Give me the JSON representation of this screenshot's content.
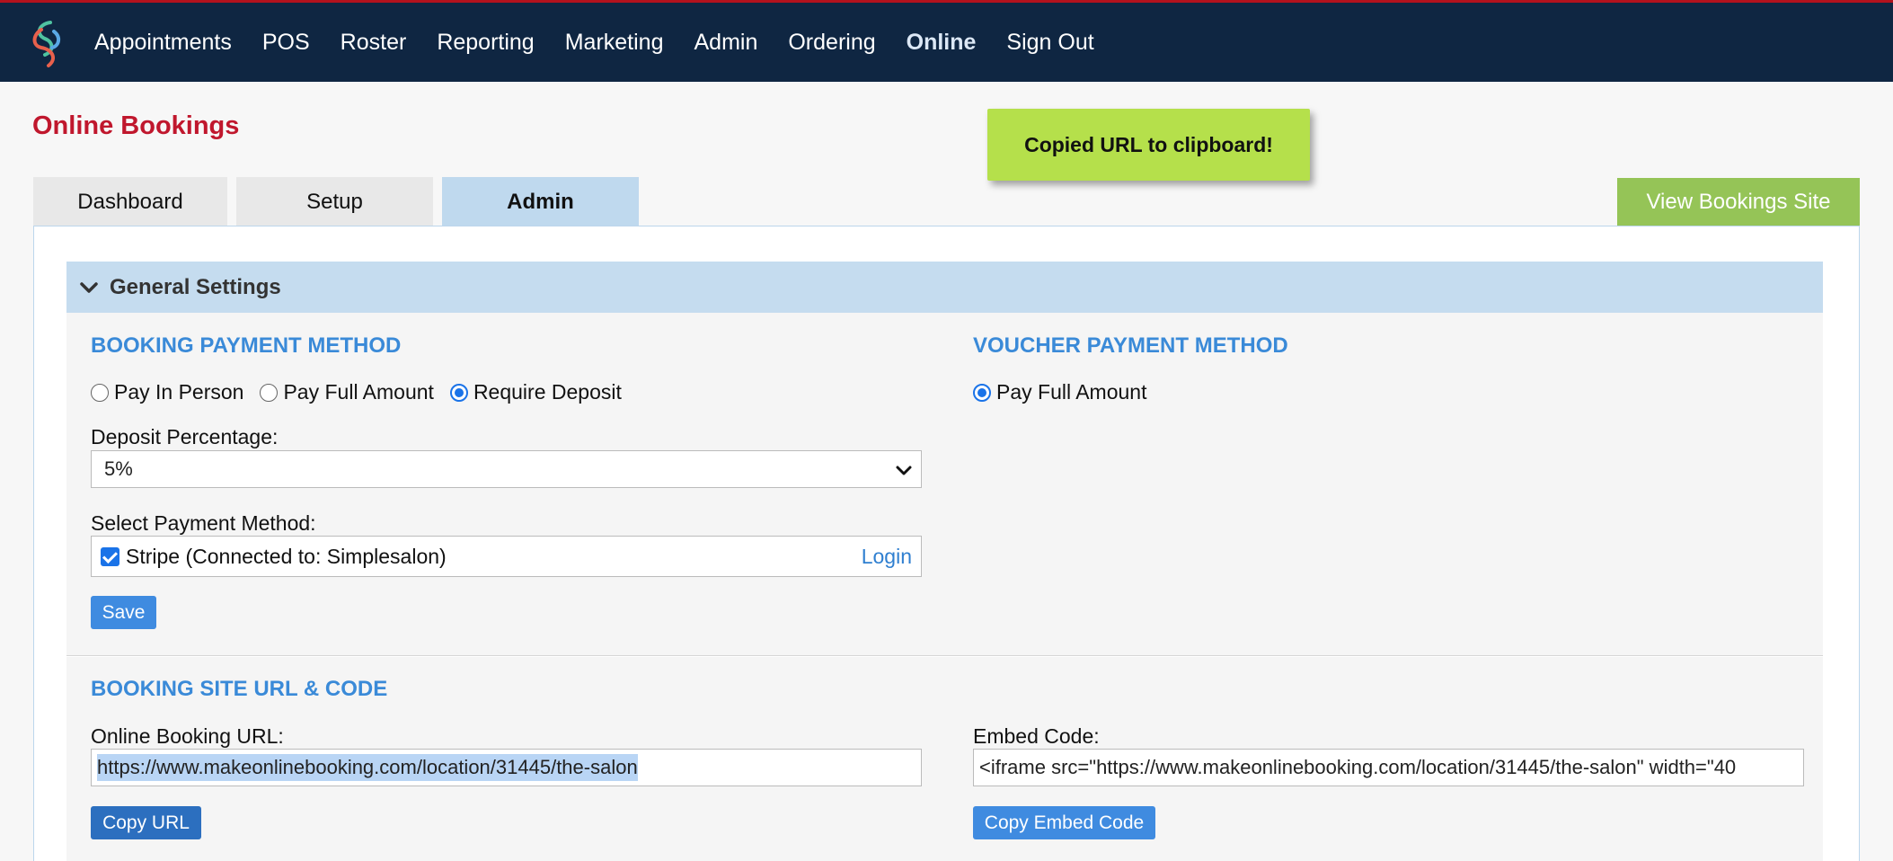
{
  "nav": {
    "items": [
      "Appointments",
      "POS",
      "Roster",
      "Reporting",
      "Marketing",
      "Admin",
      "Ordering",
      "Online",
      "Sign Out"
    ],
    "active": "Online"
  },
  "page_title": "Online Bookings",
  "toast": "Copied URL to clipboard!",
  "tabs": {
    "dashboard": "Dashboard",
    "setup": "Setup",
    "admin": "Admin",
    "active": "Admin"
  },
  "view_site_button": "View Bookings Site",
  "general_settings": {
    "title": "General Settings",
    "booking_payment": {
      "heading": "BOOKING PAYMENT METHOD",
      "options": [
        "Pay In Person",
        "Pay Full Amount",
        "Require Deposit"
      ],
      "selected": "Require Deposit",
      "deposit_label": "Deposit Percentage:",
      "deposit_value": "5%",
      "payment_method_label": "Select Payment Method:",
      "payment_method": "Stripe (Connected to: Simplesalon)",
      "payment_method_checked": true,
      "login_label": "Login",
      "save_label": "Save"
    },
    "voucher_payment": {
      "heading": "VOUCHER PAYMENT METHOD",
      "option": "Pay Full Amount",
      "selected": "Pay Full Amount"
    }
  },
  "booking_site": {
    "heading": "BOOKING SITE URL & CODE",
    "url_label": "Online Booking URL:",
    "url_value": "https://www.makeonlinebooking.com/location/31445/the-salon",
    "copy_url_label": "Copy URL",
    "embed_label": "Embed Code:",
    "embed_value": "<iframe src=\"https://www.makeonlinebooking.com/location/31445/the-salon\" width=\"40",
    "copy_embed_label": "Copy Embed Code"
  },
  "colors": {
    "nav_bg": "#0f2642",
    "title_red": "#c0172d",
    "toast_green": "#b5e04b",
    "view_button_green": "#95c457",
    "heading_blue": "#3a8ad8",
    "button_blue": "#3f8be0",
    "active_tab": "#bfd9ee"
  }
}
